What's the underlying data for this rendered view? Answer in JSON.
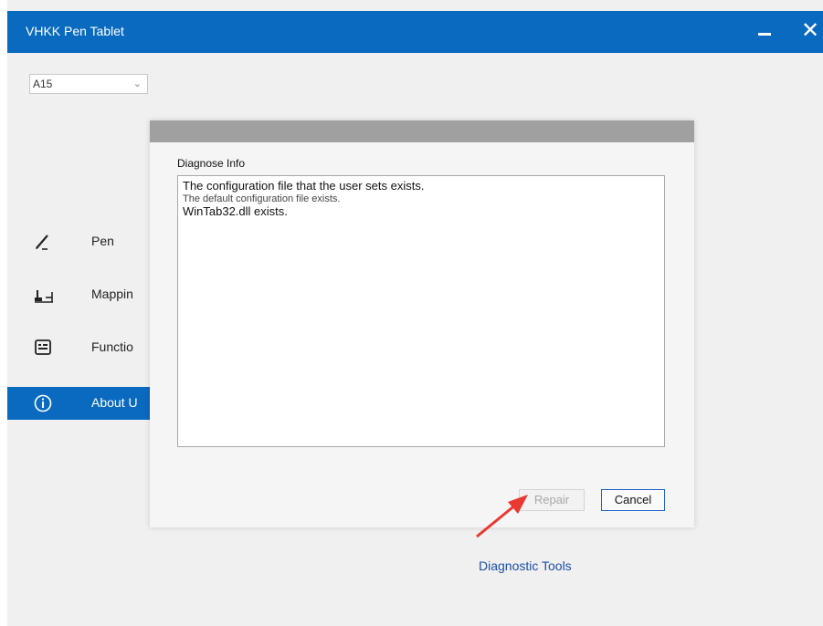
{
  "window": {
    "title": "VHKK Pen Tablet",
    "minimize_icon": "minimize-icon",
    "close_icon": "close-icon",
    "close_glyph": "✕"
  },
  "device_select": {
    "value": "A15",
    "arrow": "⌄"
  },
  "sidebar": {
    "items": [
      {
        "label": "Pen",
        "icon": "pen-icon",
        "active": false
      },
      {
        "label": "Mappin",
        "icon": "mapping-icon",
        "active": false
      },
      {
        "label": "Functio",
        "icon": "function-keys-icon",
        "active": false
      },
      {
        "label": "About U",
        "icon": "info-icon",
        "active": true
      }
    ]
  },
  "diagnostic_link": "Diagnostic Tools",
  "dialog": {
    "label": "Diagnose Info",
    "lines": [
      "The configuration file that the user sets exists.",
      "The default configuration file exists.",
      "WinTab32.dll exists."
    ],
    "repair_label": "Repair",
    "cancel_label": "Cancel"
  },
  "colors": {
    "accent": "#0a6abf",
    "dialog_header": "#a0a0a0",
    "annotation": "#e8382f",
    "link": "#1a4fa8"
  }
}
